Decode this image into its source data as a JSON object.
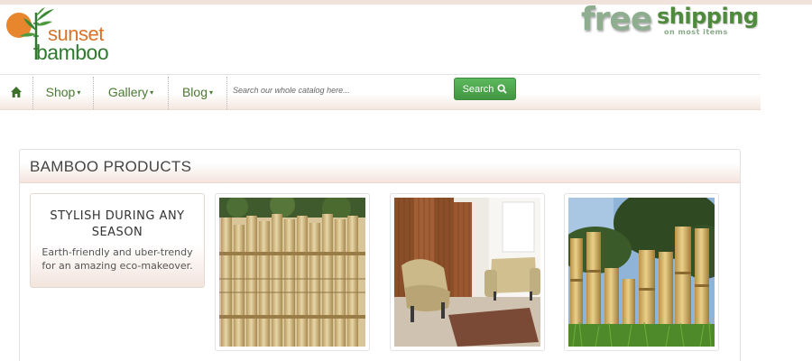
{
  "brand": {
    "logo_line1": "sunset",
    "logo_line2": "bamboo",
    "logo_sun_color": "#e8862e",
    "logo_text_orange": "#d9732a",
    "logo_text_green": "#2f7a2f"
  },
  "promo_banner": {
    "word1": "free",
    "word2": "shipping",
    "subtext": "on most items"
  },
  "nav": {
    "home_icon": "home-icon",
    "items": [
      {
        "label": "Shop",
        "caret": "▾"
      },
      {
        "label": "Gallery",
        "caret": "▾"
      },
      {
        "label": "Blog",
        "caret": "▾"
      }
    ],
    "link_color": "#4a7a32"
  },
  "search": {
    "placeholder": "Search our whole catalog here...",
    "value": "",
    "button_label": "Search",
    "button_icon": "search-icon",
    "button_color": "#5cb85c"
  },
  "products": {
    "heading": "BAMBOO PRODUCTS",
    "promo": {
      "title": "STYLISH DURING ANY SEASON",
      "text": "Earth-friendly and uber-trendy for an amazing eco-makeover."
    },
    "thumbnails": [
      {
        "icon": "bamboo-fence-image"
      },
      {
        "icon": "bamboo-room-divider-image"
      },
      {
        "icon": "bamboo-poles-image"
      }
    ]
  }
}
